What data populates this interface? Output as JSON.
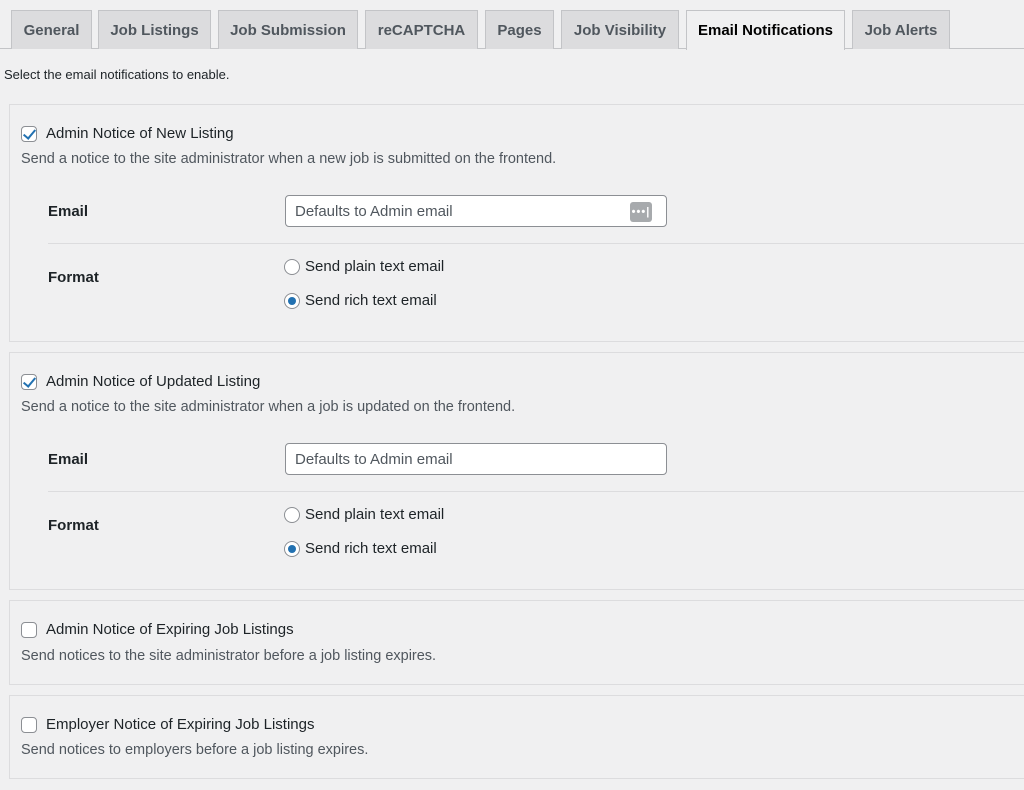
{
  "tabs": [
    {
      "label": "General"
    },
    {
      "label": "Job Listings"
    },
    {
      "label": "Job Submission"
    },
    {
      "label": "reCAPTCHA"
    },
    {
      "label": "Pages"
    },
    {
      "label": "Job Visibility"
    },
    {
      "label": "Email Notifications",
      "active": true
    },
    {
      "label": "Job Alerts"
    }
  ],
  "intro_text": "Select the email notifications to enable.",
  "sections": [
    {
      "title": "Admin Notice of New Listing",
      "checked": true,
      "description": "Send a notice to the site administrator when a new job is submitted on the frontend.",
      "email_label": "Email",
      "email_placeholder": "Defaults to Admin email",
      "password_icon": "password-manager-icon",
      "format_label": "Format",
      "format_options": [
        {
          "label": "Send plain text email",
          "selected": false
        },
        {
          "label": "Send rich text email",
          "selected": true
        }
      ]
    },
    {
      "title": "Admin Notice of Updated Listing",
      "checked": true,
      "description": "Send a notice to the site administrator when a job is updated on the frontend.",
      "email_label": "Email",
      "email_placeholder": "Defaults to Admin email",
      "format_label": "Format",
      "format_options": [
        {
          "label": "Send plain text email",
          "selected": false
        },
        {
          "label": "Send rich text email",
          "selected": true
        }
      ]
    },
    {
      "title": "Admin Notice of Expiring Job Listings",
      "checked": false,
      "description": "Send notices to the site administrator before a job listing expires."
    },
    {
      "title": "Employer Notice of Expiring Job Listings",
      "checked": false,
      "description": "Send notices to employers before a job listing expires."
    }
  ],
  "colors": {
    "accent": "#2271b1",
    "background": "#f0f0f1",
    "tab_inactive": "#dcdcde"
  }
}
